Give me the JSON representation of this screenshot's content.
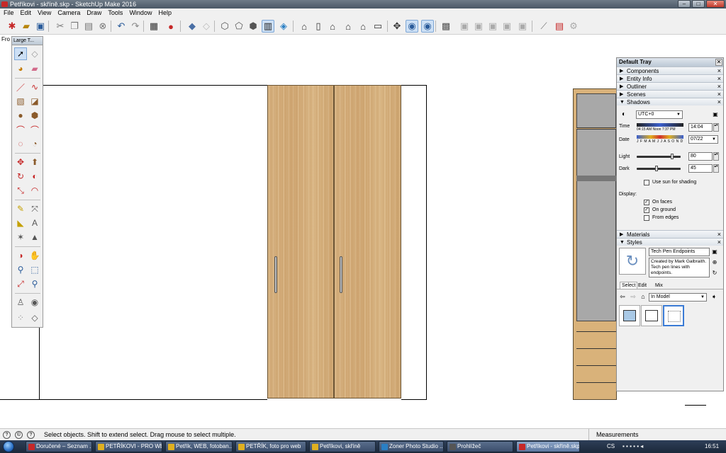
{
  "window": {
    "title": "Petříkovi - skříně.skp - SketchUp Make 2016"
  },
  "menu": [
    "File",
    "Edit",
    "View",
    "Camera",
    "Draw",
    "Tools",
    "Window",
    "Help"
  ],
  "toolbar": {
    "selected_tool": "select"
  },
  "view_label": "Fro",
  "tool_palette": {
    "title": "Large T..."
  },
  "tray": {
    "title": "Default Tray",
    "sections": {
      "components": "Components",
      "entity_info": "Entity Info",
      "outliner": "Outliner",
      "scenes": "Scenes",
      "shadows": "Shadows",
      "materials": "Materials",
      "styles": "Styles"
    },
    "shadows": {
      "timezone": "UTC+0",
      "time_label": "Time",
      "time_scale": "04:15 AM  Noon  7:37 PM",
      "time_value": "14:04",
      "date_label": "Date",
      "months": "J F M A M J J A S O N D",
      "date_value": "07/22",
      "light_label": "Light",
      "light_value": "80",
      "light_level": 0.8,
      "dark_label": "Dark",
      "dark_value": "45",
      "dark_level": 0.45,
      "use_sun": "Use sun for shading",
      "display_label": "Display:",
      "on_faces": "On faces",
      "on_ground": "On ground",
      "from_edges": "From edges"
    },
    "styles": {
      "name": "Tech Pen Endpoints",
      "description": "Created by Mark Galbraith.  Tech pen lines with endpoints.",
      "tabs": [
        "Select",
        "Edit",
        "Mix"
      ],
      "collection": "In Model"
    }
  },
  "status": {
    "message": "Select objects. Shift to extend select. Drag mouse to select multiple.",
    "measurements_label": "Measurements"
  },
  "taskbar": {
    "items": [
      "Doručené – Seznam ...",
      "PETŘÍKOVI - PRO WE...",
      "Petřík, WEB, fotoban...",
      "PETŘÍK, foto pro web",
      "Petříkovi, skříně",
      "Zoner Photo Studio ...",
      "Prohlížeč",
      "Petříkovi - skříně.skp..."
    ],
    "lang": "CS",
    "clock": "16:51"
  }
}
